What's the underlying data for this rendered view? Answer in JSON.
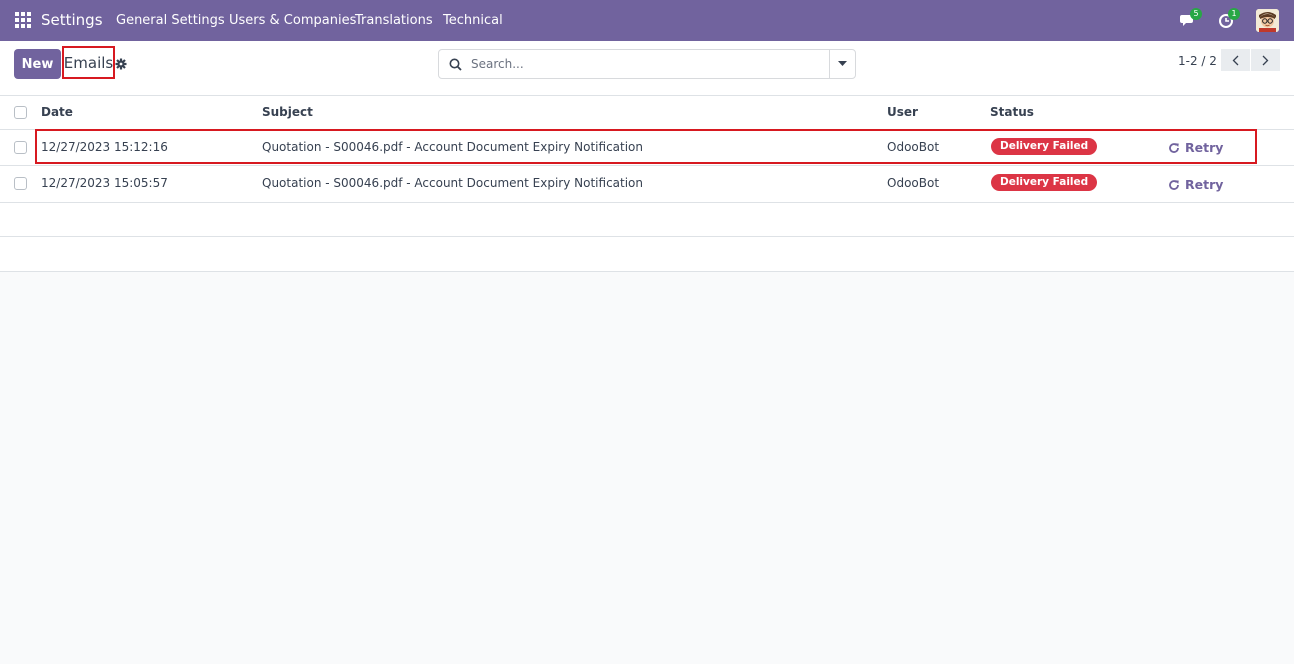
{
  "navbar": {
    "app_name": "Settings",
    "menus": [
      "General Settings",
      "Users & Companies",
      "Translations",
      "Technical"
    ],
    "messages_count": "5",
    "activities_count": "1"
  },
  "control": {
    "new_label": "New",
    "breadcrumb": "Emails",
    "search_placeholder": "Search...",
    "pager": "1-2 / 2"
  },
  "list": {
    "columns": {
      "date": "Date",
      "subject": "Subject",
      "user": "User",
      "status": "Status"
    },
    "rows": [
      {
        "date": "12/27/2023 15:12:16",
        "subject": "Quotation - S00046.pdf - Account Document Expiry Notification",
        "user": "OdooBot",
        "status": "Delivery Failed",
        "action": "Retry"
      },
      {
        "date": "12/27/2023 15:05:57",
        "subject": "Quotation - S00046.pdf - Account Document Expiry Notification",
        "user": "OdooBot",
        "status": "Delivery Failed",
        "action": "Retry"
      }
    ]
  },
  "colors": {
    "brand": "#71639e",
    "danger": "#dc3545",
    "highlight": "#d71920"
  }
}
